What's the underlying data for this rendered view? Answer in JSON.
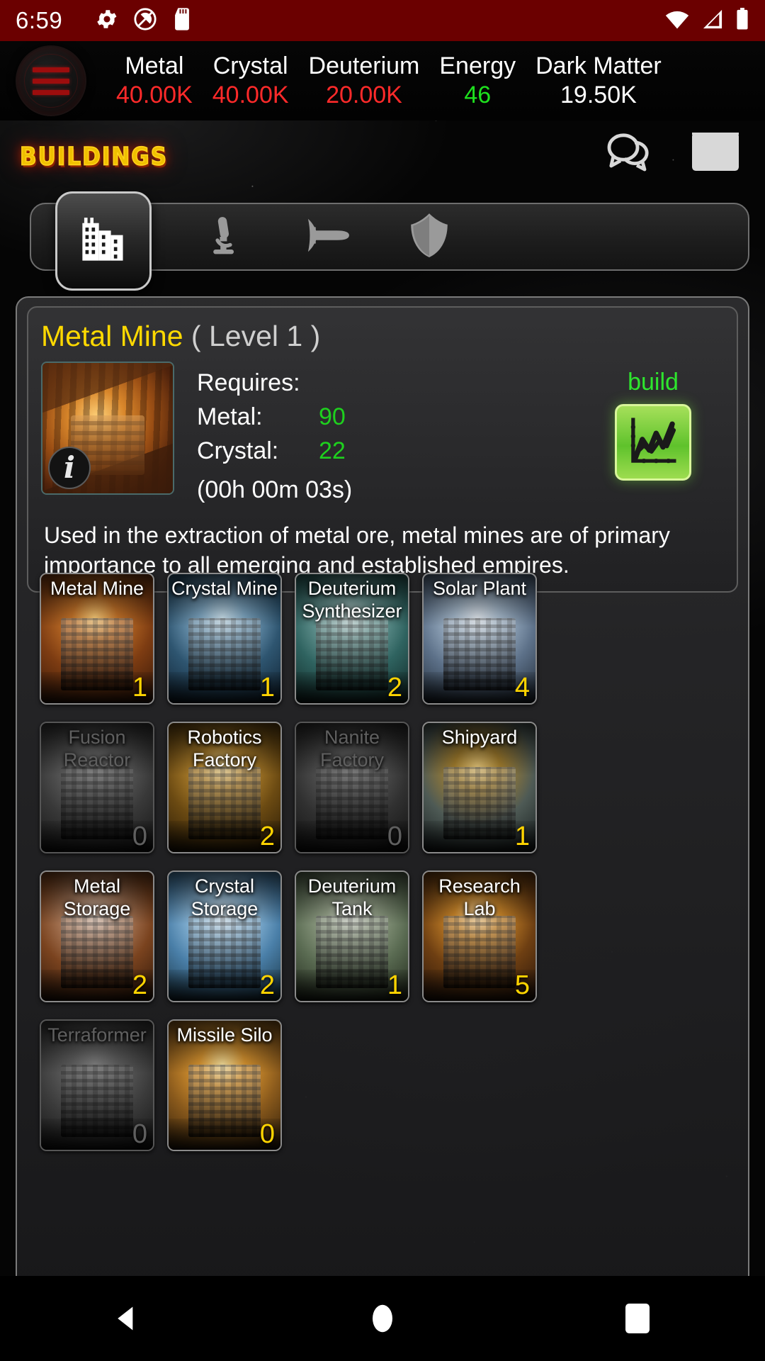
{
  "status_bar": {
    "time": "6:59",
    "left_icons": [
      "gear-icon",
      "do-not-disturb-icon",
      "sd-card-icon"
    ],
    "right_icons": [
      "wifi-icon",
      "cell-signal-icon",
      "battery-icon"
    ],
    "background_color": "#6b0000"
  },
  "resources": {
    "menu_icon": "hamburger-menu-icon",
    "items": [
      {
        "name": "Metal",
        "value": "40.00K",
        "color": "#ff2a2a"
      },
      {
        "name": "Crystal",
        "value": "40.00K",
        "color": "#ff2a2a"
      },
      {
        "name": "Deuterium",
        "value": "20.00K",
        "color": "#ff2a2a"
      },
      {
        "name": "Energy",
        "value": "46",
        "color": "#1ee01e"
      },
      {
        "name": "Dark Matter",
        "value": "19.50K",
        "color": "#ffffff"
      }
    ]
  },
  "header": {
    "title": "Buildings",
    "title_color": "#f0c000",
    "icons": [
      "chat-bubbles-icon",
      "envelope-icon"
    ]
  },
  "tabs": [
    {
      "id": "buildings",
      "icon": "buildings-icon",
      "active": true
    },
    {
      "id": "research",
      "icon": "microscope-icon",
      "active": false
    },
    {
      "id": "shipyard",
      "icon": "spaceship-icon",
      "active": false
    },
    {
      "id": "defense",
      "icon": "shield-icon",
      "active": false
    }
  ],
  "detail": {
    "name": "Metal Mine",
    "level_text": "( Level 1 )",
    "requires_label": "Requires:",
    "costs": [
      {
        "label": "Metal:",
        "amount": "90"
      },
      {
        "label": "Crystal:",
        "amount": "22"
      }
    ],
    "build_time": "(00h 00m 03s)",
    "description": "Used in the extraction of metal ore, metal mines are of primary importance to all emerging and established empires.",
    "info_badge": "i",
    "build_label": "build",
    "build_icon": "growth-chart-icon",
    "build_color": "#2ee62e"
  },
  "buildings": [
    {
      "name": "Metal Mine",
      "level": "1",
      "locked": false,
      "art": "metal-mine"
    },
    {
      "name": "Crystal Mine",
      "level": "1",
      "locked": false,
      "art": "crystal-mine"
    },
    {
      "name": "Deuterium Synthesizer",
      "level": "2",
      "locked": false,
      "art": "deuterium-synth"
    },
    {
      "name": "Solar Plant",
      "level": "4",
      "locked": false,
      "art": "solar-plant"
    },
    {
      "name": "Fusion Reactor",
      "level": "0",
      "locked": true,
      "art": "fusion-reactor"
    },
    {
      "name": "Robotics Factory",
      "level": "2",
      "locked": false,
      "art": "robotics-factory"
    },
    {
      "name": "Nanite Factory",
      "level": "0",
      "locked": true,
      "art": "nanite-factory"
    },
    {
      "name": "Shipyard",
      "level": "1",
      "locked": false,
      "art": "shipyard"
    },
    {
      "name": "Metal Storage",
      "level": "2",
      "locked": false,
      "art": "metal-storage"
    },
    {
      "name": "Crystal Storage",
      "level": "2",
      "locked": false,
      "art": "crystal-storage"
    },
    {
      "name": "Deuterium Tank",
      "level": "1",
      "locked": false,
      "art": "deuterium-tank"
    },
    {
      "name": "Research Lab",
      "level": "5",
      "locked": false,
      "art": "research-lab"
    },
    {
      "name": "Terraformer",
      "level": "0",
      "locked": true,
      "art": "terraformer"
    },
    {
      "name": "Missile Silo",
      "level": "0",
      "locked": false,
      "art": "missile-silo"
    }
  ],
  "nav_bar": {
    "buttons": [
      "back-icon",
      "home-icon",
      "recents-icon"
    ]
  }
}
